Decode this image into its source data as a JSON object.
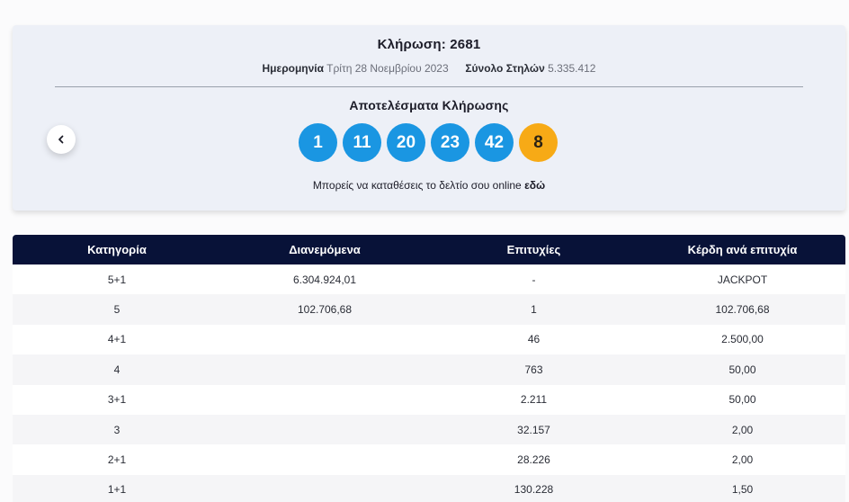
{
  "draw": {
    "title": "Κλήρωση: 2681",
    "date_label": "Ημερομηνία",
    "date_value": "Τρίτη 28 Νοεμβρίου 2023",
    "total_label": "Σύνολο Στηλών",
    "total_value": "5.335.412",
    "results_title": "Αποτελέσματα Κλήρωσης",
    "numbers": [
      "1",
      "11",
      "20",
      "23",
      "42"
    ],
    "bonus": "8",
    "online_text": "Μπορείς να καταθέσεις το δελτίο σου online",
    "online_link": "εδώ"
  },
  "colors": {
    "ball": "#1a96e2",
    "bonus_ball": "#f7aa16",
    "table_header": "#081238"
  },
  "table": {
    "headers": [
      "Κατηγορία",
      "Διανεμόμενα",
      "Επιτυχίες",
      "Κέρδη ανά επιτυχία"
    ],
    "rows": [
      [
        "5+1",
        "6.304.924,01",
        "-",
        "JACKPOT"
      ],
      [
        "5",
        "102.706,68",
        "1",
        "102.706,68"
      ],
      [
        "4+1",
        "",
        "46",
        "2.500,00"
      ],
      [
        "4",
        "",
        "763",
        "50,00"
      ],
      [
        "3+1",
        "",
        "2.211",
        "50,00"
      ],
      [
        "3",
        "",
        "32.157",
        "2,00"
      ],
      [
        "2+1",
        "",
        "28.226",
        "2,00"
      ],
      [
        "1+1",
        "",
        "130.228",
        "1,50"
      ]
    ]
  }
}
